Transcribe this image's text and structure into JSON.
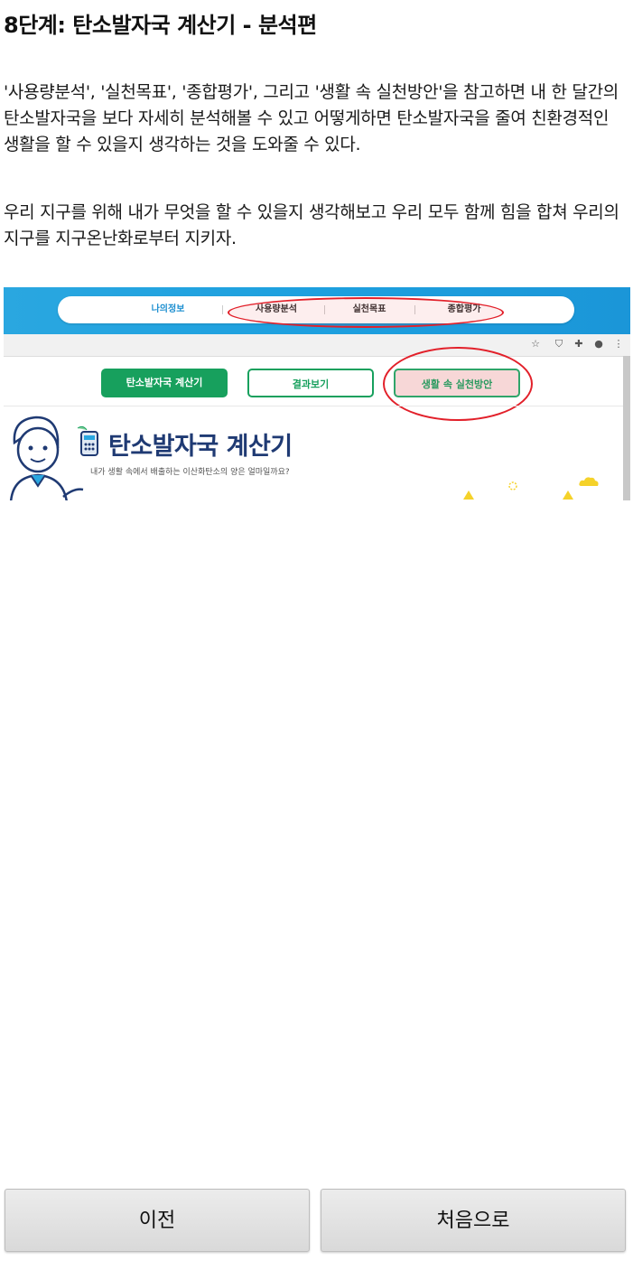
{
  "page": {
    "title": "8단계: 탄소발자국 계산기 - 분석편",
    "paragraphs": [
      "'사용량분석', '실천목표', '종합평가', 그리고 '생활 속 실천방안'을 참고하면 내 한 달간의 탄소발자국을 보다 자세히 분석해볼 수 있고 어떻게하면 탄소발자국을 줄여 친환경적인 생활을 할 수 있을지 생각하는 것을 도와줄 수 있다.",
      "우리 지구를 위해 내가 무엇을 할 수 있을지 생각해보고 우리 모두 함께 힘을 합쳐 우리의 지구를 지구온난화로부터 지키자."
    ]
  },
  "screenshot": {
    "nav_items": [
      "나의정보",
      "사용량분석",
      "실천목표",
      "종합평가"
    ],
    "buttons": [
      "탄소발자국 계산기",
      "결과보기",
      "생활 속 실천방안"
    ],
    "heading": "탄소발자국 계산기",
    "subheading": "내가 생활 속에서 배출하는 이산화탄소의 양은 얼마일까요?",
    "colors": {
      "nav_bar": "#1da0df",
      "green": "#17a05d",
      "highlight": "#e2202a",
      "heading": "#1f3a73"
    }
  },
  "nav_buttons": {
    "prev": "이전",
    "home": "처음으로"
  }
}
